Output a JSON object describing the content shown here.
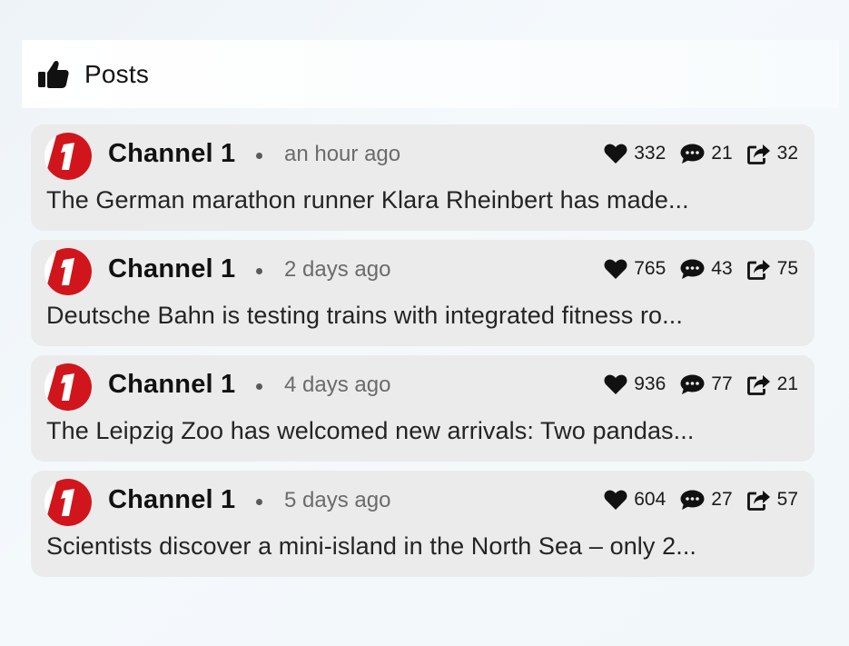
{
  "header": {
    "title": "Posts",
    "icon": "thumbs-up-icon"
  },
  "colors": {
    "card_background": "#ebebeb",
    "brand_red": "#d0161c"
  },
  "posts": [
    {
      "channel": "Channel 1",
      "time": "an hour ago",
      "likes": "332",
      "comments": "21",
      "shares": "32",
      "text": "The German marathon runner Klara Rheinbert has made..."
    },
    {
      "channel": "Channel 1",
      "time": "2 days ago",
      "likes": "765",
      "comments": "43",
      "shares": "75",
      "text": "Deutsche Bahn is testing trains with integrated fitness ro..."
    },
    {
      "channel": "Channel 1",
      "time": "4 days ago",
      "likes": "936",
      "comments": "77",
      "shares": "21",
      "text": "The Leipzig Zoo has welcomed new arrivals: Two pandas..."
    },
    {
      "channel": "Channel 1",
      "time": "5 days ago",
      "likes": "604",
      "comments": "27",
      "shares": "57",
      "text": "Scientists discover a mini-island in the North Sea – only 2..."
    }
  ]
}
